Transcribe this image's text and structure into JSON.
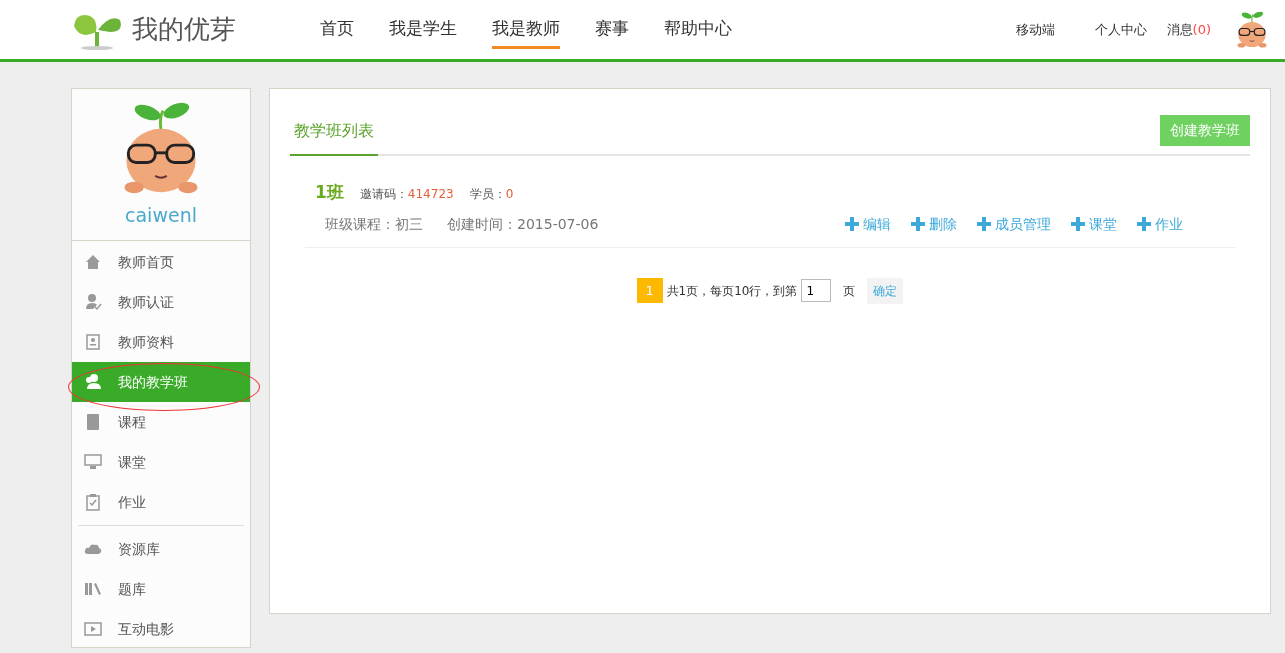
{
  "header": {
    "logo_text": "我的优芽",
    "nav": [
      {
        "label": "首页",
        "selected": false
      },
      {
        "label": "我是学生",
        "selected": false
      },
      {
        "label": "我是教师",
        "selected": true
      },
      {
        "label": "赛事",
        "selected": false
      },
      {
        "label": "帮助中心",
        "selected": false
      }
    ],
    "links": [
      "移动端",
      "个人中心"
    ],
    "messages": {
      "label": "消息",
      "count": "(0)"
    }
  },
  "sidebar": {
    "username": "caiwenl",
    "groups": [
      {
        "items": [
          {
            "label": "教师首页",
            "selected": false
          },
          {
            "label": "教师认证",
            "selected": false
          },
          {
            "label": "教师资料",
            "selected": false
          },
          {
            "label": "我的教学班",
            "selected": true
          },
          {
            "label": "课程",
            "selected": false
          },
          {
            "label": "课堂",
            "selected": false
          },
          {
            "label": "作业",
            "selected": false
          }
        ]
      },
      {
        "items": [
          {
            "label": "资源库",
            "selected": false
          },
          {
            "label": "题库",
            "selected": false
          },
          {
            "label": "互动电影",
            "selected": false
          }
        ]
      }
    ]
  },
  "main": {
    "tab": "教学班列表",
    "create_button": "创建教学班",
    "classes": [
      {
        "name": "1班",
        "invite_label": "邀请码：",
        "invite_code": "414723",
        "members_label": "学员：",
        "members": "0",
        "course": "班级课程：初三",
        "created": "创建时间：2015-07-06",
        "actions": [
          "编辑",
          "删除",
          "成员管理",
          "课堂",
          "作业"
        ]
      }
    ],
    "pagination": {
      "page": "1",
      "summary": "共1页，每页10行，到第",
      "input_value": "1",
      "page_unit": "页",
      "confirm": "确定"
    }
  }
}
